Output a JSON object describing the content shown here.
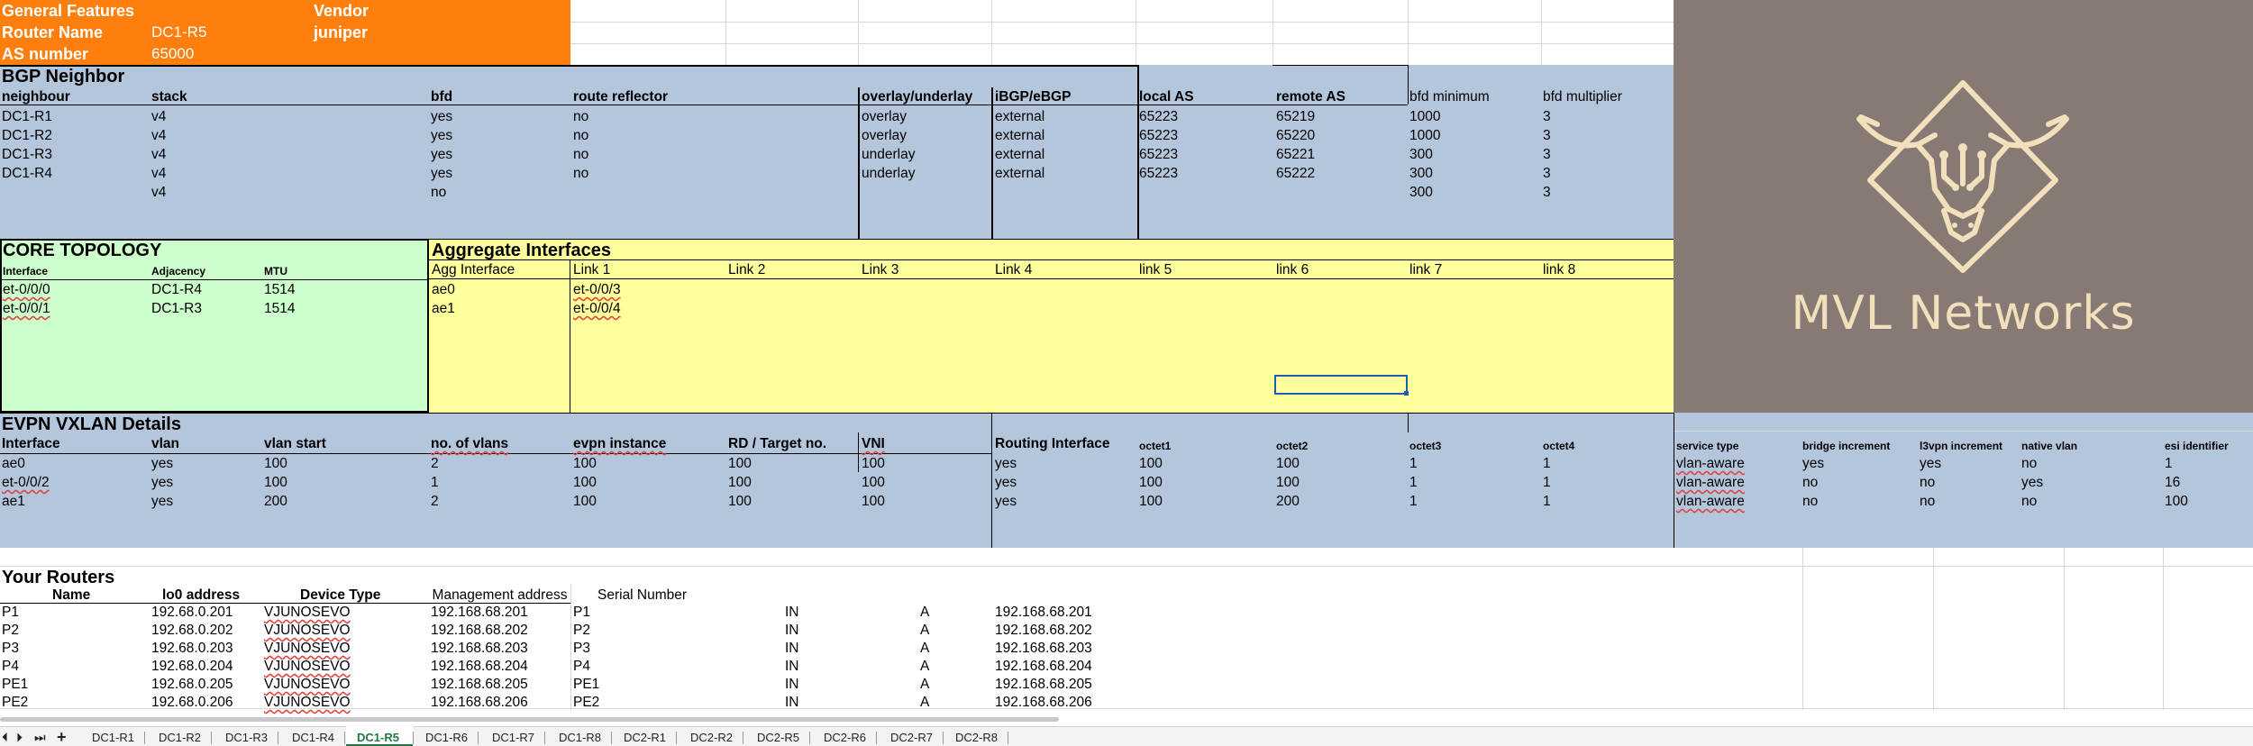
{
  "general": {
    "title": "General Features",
    "vendor_label": "Vendor",
    "vendor_value": "juniper",
    "router_name_label": "Router Name",
    "router_name_value": "DC1-R5",
    "as_label": "AS number",
    "as_value": "65000"
  },
  "bgp": {
    "title": "BGP Neighbor",
    "headers": [
      "neighbour",
      "stack",
      "bfd",
      "route reflector",
      "overlay/underlay",
      "iBGP/eBGP",
      "local AS",
      "remote AS",
      "bfd minimum",
      "bfd multiplier"
    ],
    "rows": [
      [
        "DC1-R1",
        "v4",
        "yes",
        "no",
        "overlay",
        "external",
        "65223",
        "65219",
        "1000",
        "3"
      ],
      [
        "DC1-R2",
        "v4",
        "yes",
        "no",
        "overlay",
        "external",
        "65223",
        "65220",
        "1000",
        "3"
      ],
      [
        "DC1-R3",
        "v4",
        "yes",
        "no",
        "underlay",
        "external",
        "65223",
        "65221",
        "300",
        "3"
      ],
      [
        "DC1-R4",
        "v4",
        "yes",
        "no",
        "underlay",
        "external",
        "65223",
        "65222",
        "300",
        "3"
      ],
      [
        "",
        "v4",
        "no",
        "",
        "",
        "",
        "",
        "",
        "300",
        "3"
      ]
    ]
  },
  "core": {
    "title": "CORE TOPOLOGY",
    "headers": [
      "Interface",
      "Adjacency",
      "MTU"
    ],
    "rows": [
      [
        "et-0/0/0",
        "DC1-R4",
        "1514"
      ],
      [
        "et-0/0/1",
        "DC1-R3",
        "1514"
      ]
    ]
  },
  "agg": {
    "title": "Aggregate Interfaces",
    "headers": [
      "Agg Interface",
      "Link 1",
      "Link 2",
      "Link 3",
      "Link 4",
      "link 5",
      "link 6",
      "link 7",
      "link 8"
    ],
    "rows": [
      [
        "ae0",
        "et-0/0/3"
      ],
      [
        "ae1",
        "et-0/0/4"
      ]
    ]
  },
  "evpn": {
    "title": "EVPN VXLAN Details",
    "headers": [
      "Interface",
      "vlan",
      "vlan start",
      "no. of vlans",
      "evpn instance",
      "RD / Target no.",
      "VNI",
      "Routing Interface",
      "octet1",
      "octet2",
      "octet3",
      "octet4",
      "service type",
      "bridge increment",
      "l3vpn increment",
      "native vlan",
      "esi identifier"
    ],
    "rows": [
      [
        "ae0",
        "yes",
        "100",
        "2",
        "100",
        "100",
        "100",
        "yes",
        "100",
        "100",
        "1",
        "1",
        "vlan-aware",
        "yes",
        "yes",
        "no",
        "1"
      ],
      [
        "et-0/0/2",
        "yes",
        "100",
        "1",
        "100",
        "100",
        "100",
        "yes",
        "100",
        "100",
        "1",
        "1",
        "vlan-aware",
        "no",
        "no",
        "yes",
        "16"
      ],
      [
        "ae1",
        "yes",
        "200",
        "2",
        "100",
        "100",
        "100",
        "yes",
        "100",
        "200",
        "1",
        "1",
        "vlan-aware",
        "no",
        "no",
        "no",
        "100"
      ]
    ]
  },
  "routers": {
    "title": "Your Routers",
    "headers": [
      "Name",
      "lo0 address",
      "Device Type",
      "Management address",
      "Serial Number"
    ],
    "rows": [
      [
        "P1",
        "192.68.0.201",
        "VJUNOSEVO",
        "192.168.68.201",
        "P1",
        "IN",
        "A",
        "192.168.68.201"
      ],
      [
        "P2",
        "192.68.0.202",
        "VJUNOSEVO",
        "192.168.68.202",
        "P2",
        "IN",
        "A",
        "192.168.68.202"
      ],
      [
        "P3",
        "192.68.0.203",
        "VJUNOSEVO",
        "192.168.68.203",
        "P3",
        "IN",
        "A",
        "192.168.68.203"
      ],
      [
        "P4",
        "192.68.0.204",
        "VJUNOSEVO",
        "192.168.68.204",
        "P4",
        "IN",
        "A",
        "192.168.68.204"
      ],
      [
        "PE1",
        "192.68.0.205",
        "VJUNOSEVO",
        "192.168.68.205",
        "PE1",
        "IN",
        "A",
        "192.168.68.205"
      ],
      [
        "PE2",
        "192.68.0.206",
        "VJUNOSEVO",
        "192.168.68.206",
        "PE2",
        "IN",
        "A",
        "192.168.68.206"
      ]
    ]
  },
  "logo": {
    "text": "MVL Networks",
    "icon": "bull-head-logo-icon",
    "bg_color": "#877a74",
    "fg_color": "#f2dfbc"
  },
  "colors": {
    "orange": "#ff7f0e",
    "steel_blue": "#b4c6dc",
    "mint": "#ccffcc",
    "yellow": "#ffff9c"
  },
  "tabs": {
    "nav": [
      "⏴",
      "⏵",
      "⏭",
      "+"
    ],
    "sheets": [
      "DC1-R1",
      "DC1-R2",
      "DC1-R3",
      "DC1-R4",
      "DC1-R5",
      "DC1-R6",
      "DC1-R7",
      "DC1-R8",
      "DC2-R1",
      "DC2-R2",
      "DC2-R5",
      "DC2-R6",
      "DC2-R7",
      "DC2-R8"
    ],
    "active": "DC1-R5"
  }
}
